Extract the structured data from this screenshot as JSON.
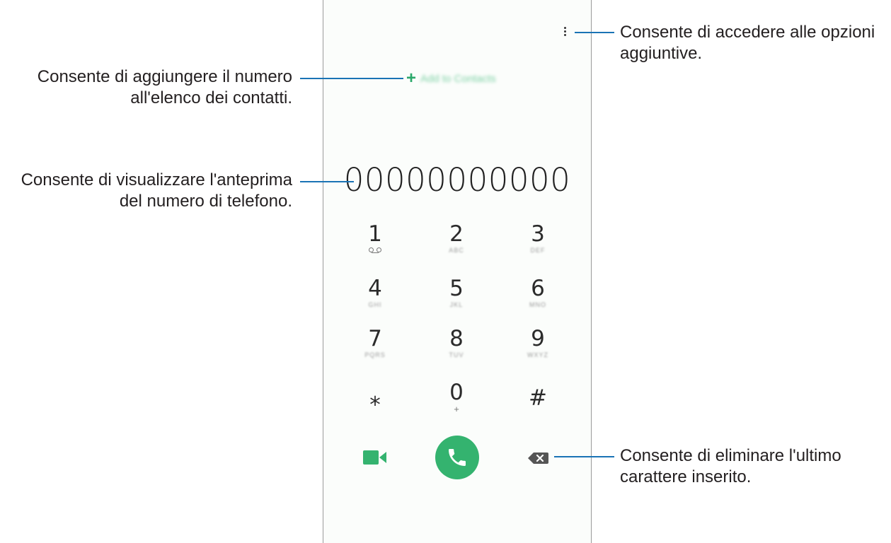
{
  "dialer": {
    "add_to_contacts": "Add to Contacts",
    "phone_number": "00000000000",
    "keys": [
      {
        "digit": "1",
        "letters": ""
      },
      {
        "digit": "2",
        "letters": "ABC"
      },
      {
        "digit": "3",
        "letters": "DEF"
      },
      {
        "digit": "4",
        "letters": "GHI"
      },
      {
        "digit": "5",
        "letters": "JKL"
      },
      {
        "digit": "6",
        "letters": "MNO"
      },
      {
        "digit": "7",
        "letters": "PQRS"
      },
      {
        "digit": "8",
        "letters": "TUV"
      },
      {
        "digit": "9",
        "letters": "WXYZ"
      },
      {
        "digit": "⁎",
        "letters": ""
      },
      {
        "digit": "0",
        "letters": "+"
      },
      {
        "digit": "#",
        "letters": ""
      }
    ],
    "icons": {
      "menu": "more-options-icon",
      "add": "plus-icon",
      "voicemail": "voicemail-icon",
      "video": "video-call-icon",
      "call": "phone-icon",
      "backspace": "backspace-icon"
    },
    "accent_color": "#34b36f"
  },
  "callouts": {
    "options": {
      "line1": "Consente di accedere alle opzioni",
      "line2": "aggiuntive."
    },
    "add_contact": {
      "line1": "Consente di aggiungere il numero",
      "line2": "all'elenco dei contatti."
    },
    "preview": {
      "line1": "Consente di visualizzare l'anteprima",
      "line2": "del numero di telefono."
    },
    "delete": {
      "line1": "Consente di eliminare l'ultimo",
      "line2": "carattere inserito."
    },
    "leader_color": "#1a73b5"
  }
}
